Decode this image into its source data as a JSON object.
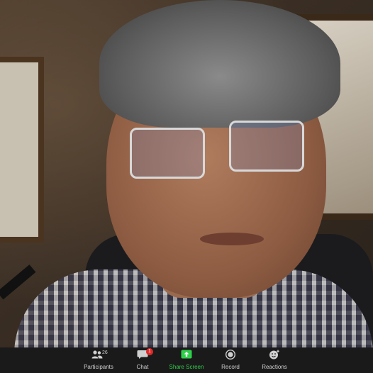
{
  "toolbar": {
    "participants": {
      "label": "Participants",
      "count": "26",
      "icon": "participants-icon"
    },
    "chat": {
      "label": "Chat",
      "badge": "1",
      "icon": "chat-icon"
    },
    "share_screen": {
      "label": "Share Screen",
      "icon": "share-screen-icon",
      "color": "#2fcf4a"
    },
    "record": {
      "label": "Record",
      "icon": "record-icon"
    },
    "reactions": {
      "label": "Reactions",
      "icon": "reactions-icon"
    }
  }
}
